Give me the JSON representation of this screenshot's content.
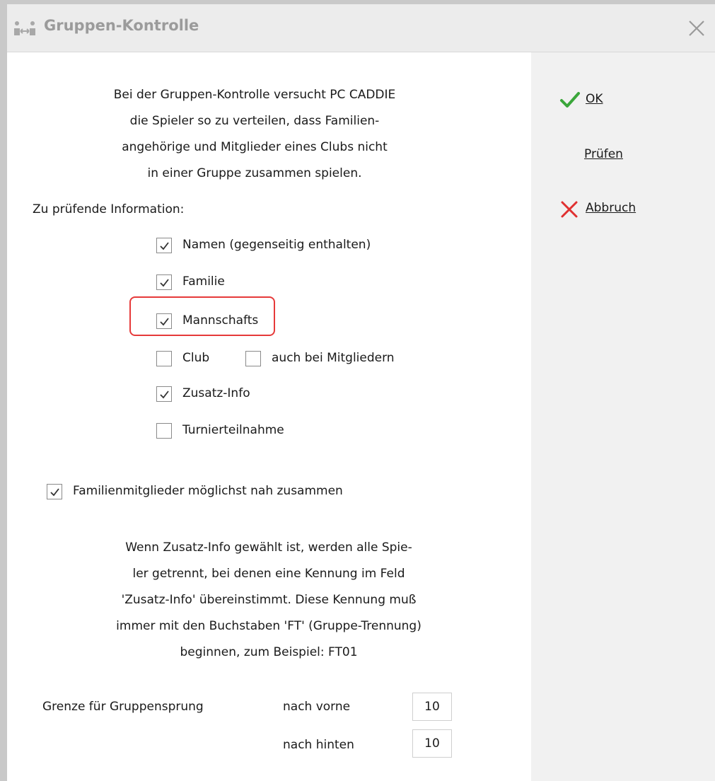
{
  "window": {
    "title": "Gruppen-Kontrolle"
  },
  "intro": {
    "lines": [
      "Bei der Gruppen-Kontrolle versucht PC CADDIE",
      "die Spieler so zu verteilen, dass Familien-",
      "angehörige und Mitglieder eines Clubs nicht",
      "in einer Gruppe zusammen spielen."
    ]
  },
  "section": {
    "label": "Zu prüfende Information:"
  },
  "checks": {
    "namen": {
      "label": "Namen (gegenseitig enthalten)",
      "checked": true
    },
    "familie": {
      "label": "Familie",
      "checked": true
    },
    "mannschaft": {
      "label": "Mannschafts",
      "checked": true
    },
    "club": {
      "label": "Club",
      "checked": false
    },
    "mitglieder": {
      "label": "auch bei Mitgliedern",
      "checked": false
    },
    "zusatz": {
      "label": "Zusatz-Info",
      "checked": true
    },
    "turnier": {
      "label": "Turnierteilnahme",
      "checked": false
    },
    "familienmitglieder": {
      "label": "Familienmitglieder möglichst nah zusammen",
      "checked": true
    }
  },
  "note": {
    "lines": [
      "Wenn Zusatz-Info gewählt ist, werden alle Spie-",
      "ler getrennt, bei denen eine Kennung im Feld",
      "'Zusatz-Info' übereinstimmt. Diese Kennung muß",
      "immer mit den Buchstaben 'FT' (Gruppe-Trennung)",
      "beginnen, zum Beispiel: FT01"
    ]
  },
  "limit": {
    "label": "Grenze für Gruppensprung",
    "forward_label": "nach vorne",
    "forward_value": "10",
    "backward_label": "nach hinten",
    "backward_value": "10"
  },
  "buttons": {
    "ok": "OK",
    "pruefen": "Prüfen",
    "abbruch": "Abbruch"
  },
  "colors": {
    "ok_green": "#3aa63a",
    "cancel_red": "#e03030",
    "highlight": "#e63a3a",
    "side_bg": "#f1f1f1",
    "title_gray": "#9b9b9b"
  }
}
